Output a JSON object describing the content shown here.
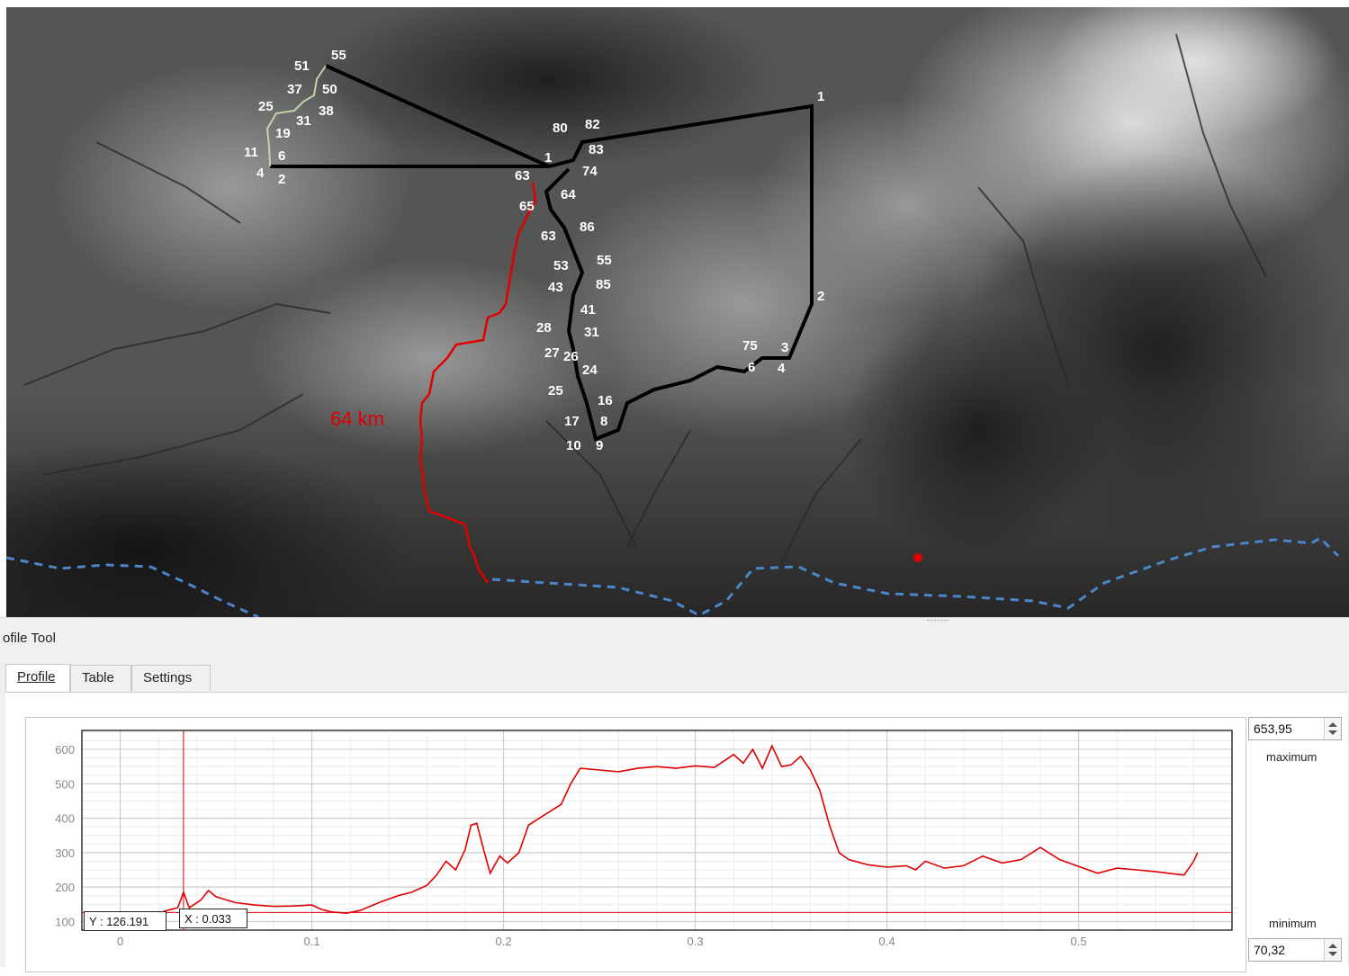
{
  "colors": {
    "profile_line": "#e00000",
    "route": "#000000",
    "red_route": "#e00000",
    "border": "#4a86c8"
  },
  "map": {
    "distance_label": "64 km",
    "route_labels": {
      "west": [
        "55",
        "51",
        "50",
        "37",
        "38",
        "25",
        "31",
        "19",
        "11",
        "6",
        "4",
        "2"
      ],
      "center": [
        "1",
        "80",
        "82",
        "83",
        "74",
        "63",
        "64",
        "65",
        "86",
        "63",
        "55",
        "53",
        "85",
        "43",
        "41",
        "28",
        "31",
        "27",
        "26",
        "24",
        "25",
        "16",
        "17",
        "8",
        "10",
        "9"
      ],
      "east": [
        "1",
        "2",
        "75",
        "3",
        "6",
        "4"
      ]
    }
  },
  "panel": {
    "title": "ofile Tool",
    "tabs": [
      {
        "label": "Profile",
        "active": true
      },
      {
        "label": "Table",
        "active": false
      },
      {
        "label": "Settings",
        "active": false
      }
    ],
    "max_value": "653,95",
    "max_label": "maximum",
    "min_value": "70,32",
    "min_label": "minimum",
    "readout_y": "Y : 126.191",
    "readout_x": "X : 0.033"
  },
  "chart_data": {
    "type": "line",
    "xlabel": "",
    "ylabel": "",
    "x_ticks": [
      "0",
      "0.1",
      "0.2",
      "0.3",
      "0.4",
      "0.5"
    ],
    "y_ticks": [
      "100",
      "200",
      "300",
      "400",
      "500",
      "600"
    ],
    "xlim": [
      -0.02,
      0.58
    ],
    "ylim": [
      75,
      655
    ],
    "cursor_x": 0.033,
    "cursor_y": 126.191,
    "series": [
      {
        "values_xy": [
          [
            0,
            122
          ],
          [
            0.01,
            121
          ],
          [
            0.02,
            124
          ],
          [
            0.025,
            133
          ],
          [
            0.03,
            140
          ],
          [
            0.033,
            185
          ],
          [
            0.036,
            140
          ],
          [
            0.042,
            162
          ],
          [
            0.046,
            190
          ],
          [
            0.05,
            172
          ],
          [
            0.06,
            155
          ],
          [
            0.07,
            148
          ],
          [
            0.08,
            144
          ],
          [
            0.09,
            145
          ],
          [
            0.1,
            148
          ],
          [
            0.105,
            135
          ],
          [
            0.11,
            128
          ],
          [
            0.118,
            124
          ],
          [
            0.125,
            132
          ],
          [
            0.135,
            155
          ],
          [
            0.145,
            175
          ],
          [
            0.152,
            185
          ],
          [
            0.16,
            205
          ],
          [
            0.165,
            235
          ],
          [
            0.17,
            275
          ],
          [
            0.175,
            250
          ],
          [
            0.18,
            310
          ],
          [
            0.183,
            380
          ],
          [
            0.186,
            385
          ],
          [
            0.19,
            300
          ],
          [
            0.193,
            240
          ],
          [
            0.198,
            290
          ],
          [
            0.202,
            270
          ],
          [
            0.208,
            300
          ],
          [
            0.213,
            380
          ],
          [
            0.22,
            405
          ],
          [
            0.23,
            440
          ],
          [
            0.235,
            500
          ],
          [
            0.24,
            545
          ],
          [
            0.25,
            540
          ],
          [
            0.26,
            535
          ],
          [
            0.27,
            545
          ],
          [
            0.28,
            550
          ],
          [
            0.29,
            545
          ],
          [
            0.3,
            552
          ],
          [
            0.31,
            548
          ],
          [
            0.32,
            585
          ],
          [
            0.325,
            560
          ],
          [
            0.33,
            600
          ],
          [
            0.335,
            545
          ],
          [
            0.34,
            610
          ],
          [
            0.345,
            550
          ],
          [
            0.35,
            555
          ],
          [
            0.355,
            580
          ],
          [
            0.36,
            540
          ],
          [
            0.365,
            480
          ],
          [
            0.37,
            380
          ],
          [
            0.375,
            300
          ],
          [
            0.38,
            280
          ],
          [
            0.39,
            265
          ],
          [
            0.4,
            258
          ],
          [
            0.41,
            262
          ],
          [
            0.415,
            250
          ],
          [
            0.42,
            275
          ],
          [
            0.43,
            255
          ],
          [
            0.44,
            262
          ],
          [
            0.45,
            290
          ],
          [
            0.46,
            270
          ],
          [
            0.47,
            280
          ],
          [
            0.48,
            315
          ],
          [
            0.49,
            280
          ],
          [
            0.5,
            260
          ],
          [
            0.51,
            240
          ],
          [
            0.52,
            255
          ],
          [
            0.53,
            250
          ],
          [
            0.54,
            245
          ],
          [
            0.55,
            238
          ],
          [
            0.555,
            235
          ],
          [
            0.56,
            275
          ],
          [
            0.562,
            300
          ]
        ]
      }
    ]
  }
}
